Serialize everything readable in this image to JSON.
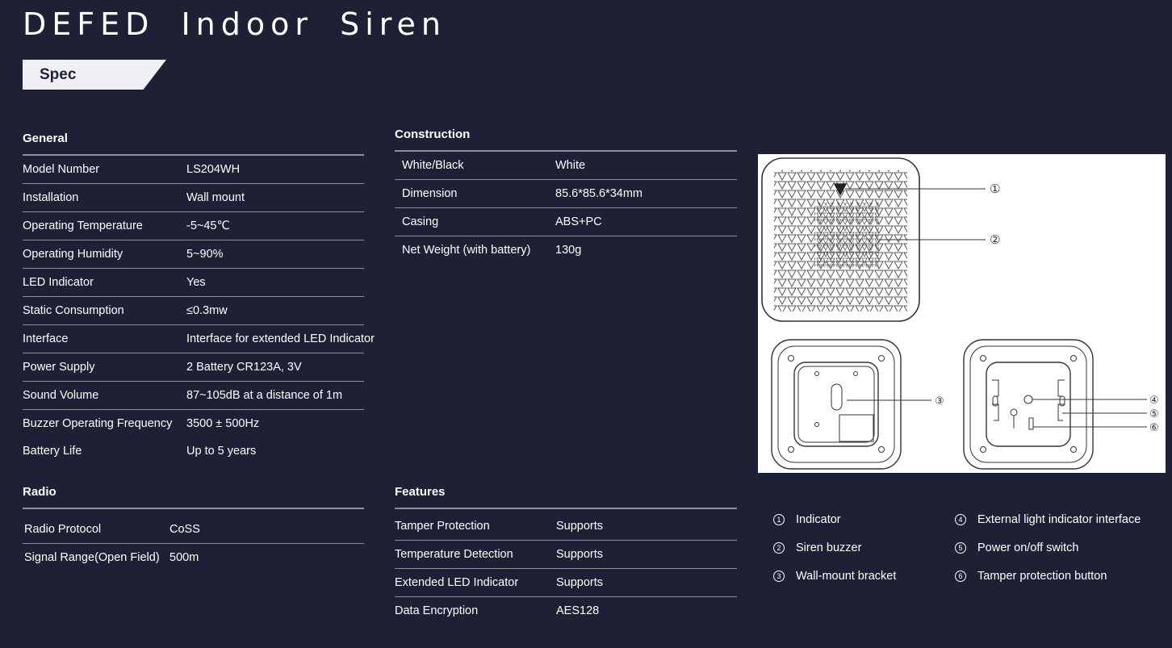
{
  "page": {
    "title": "DEFED Indoor Siren",
    "spec_label": "Spec"
  },
  "general": {
    "title": "General",
    "rows": [
      {
        "key": "Model Number",
        "value": "LS204WH"
      },
      {
        "key": "Installation",
        "value": "Wall mount"
      },
      {
        "key": "Operating Temperature",
        "value": "-5~45℃"
      },
      {
        "key": "Operating Humidity",
        "value": "5~90%"
      },
      {
        "key": "LED Indicator",
        "value": "Yes"
      },
      {
        "key": "Static Consumption",
        "value": "≤0.3mw"
      },
      {
        "key": "Interface",
        "value": "Interface for extended LED Indicator"
      },
      {
        "key": "Power Supply",
        "value": "2 Battery CR123A, 3V"
      },
      {
        "key": "Sound Volume",
        "value": "87~105dB at a distance of 1m"
      },
      {
        "key": "Buzzer Operating Frequency",
        "value": "3500 ± 500Hz"
      },
      {
        "key": "Battery Life",
        "value": "Up to 5 years"
      }
    ]
  },
  "construction": {
    "title": "Construction",
    "rows": [
      {
        "key": "White/Black",
        "value": "White"
      },
      {
        "key": "Dimension",
        "value": "85.6*85.6*34mm"
      },
      {
        "key": "Casing",
        "value": "ABS+PC"
      },
      {
        "key": "Net Weight (with battery)",
        "value": "130g"
      }
    ]
  },
  "radio": {
    "title": "Radio",
    "rows": [
      {
        "key": "Radio Protocol",
        "value": "CoSS"
      },
      {
        "key": "Signal Range(Open Field)",
        "value": "500m"
      }
    ]
  },
  "features": {
    "title": "Features",
    "rows": [
      {
        "key": "Tamper Protection",
        "value": "Supports"
      },
      {
        "key": "Temperature Detection",
        "value": "Supports"
      },
      {
        "key": "Extended LED Indicator",
        "value": "Supports"
      },
      {
        "key": "Data Encryption",
        "value": "AES128"
      }
    ]
  },
  "diagram": {
    "callouts": [
      "①",
      "②",
      "③",
      "④",
      "⑤",
      "⑥"
    ]
  },
  "legend": {
    "left": [
      {
        "num": "1",
        "label": "Indicator"
      },
      {
        "num": "2",
        "label": "Siren buzzer"
      },
      {
        "num": "3",
        "label": "Wall-mount bracket"
      }
    ],
    "right": [
      {
        "num": "4",
        "label": "External light indicator interface"
      },
      {
        "num": "5",
        "label": "Power on/off switch"
      },
      {
        "num": "6",
        "label": "Tamper protection button"
      }
    ]
  }
}
